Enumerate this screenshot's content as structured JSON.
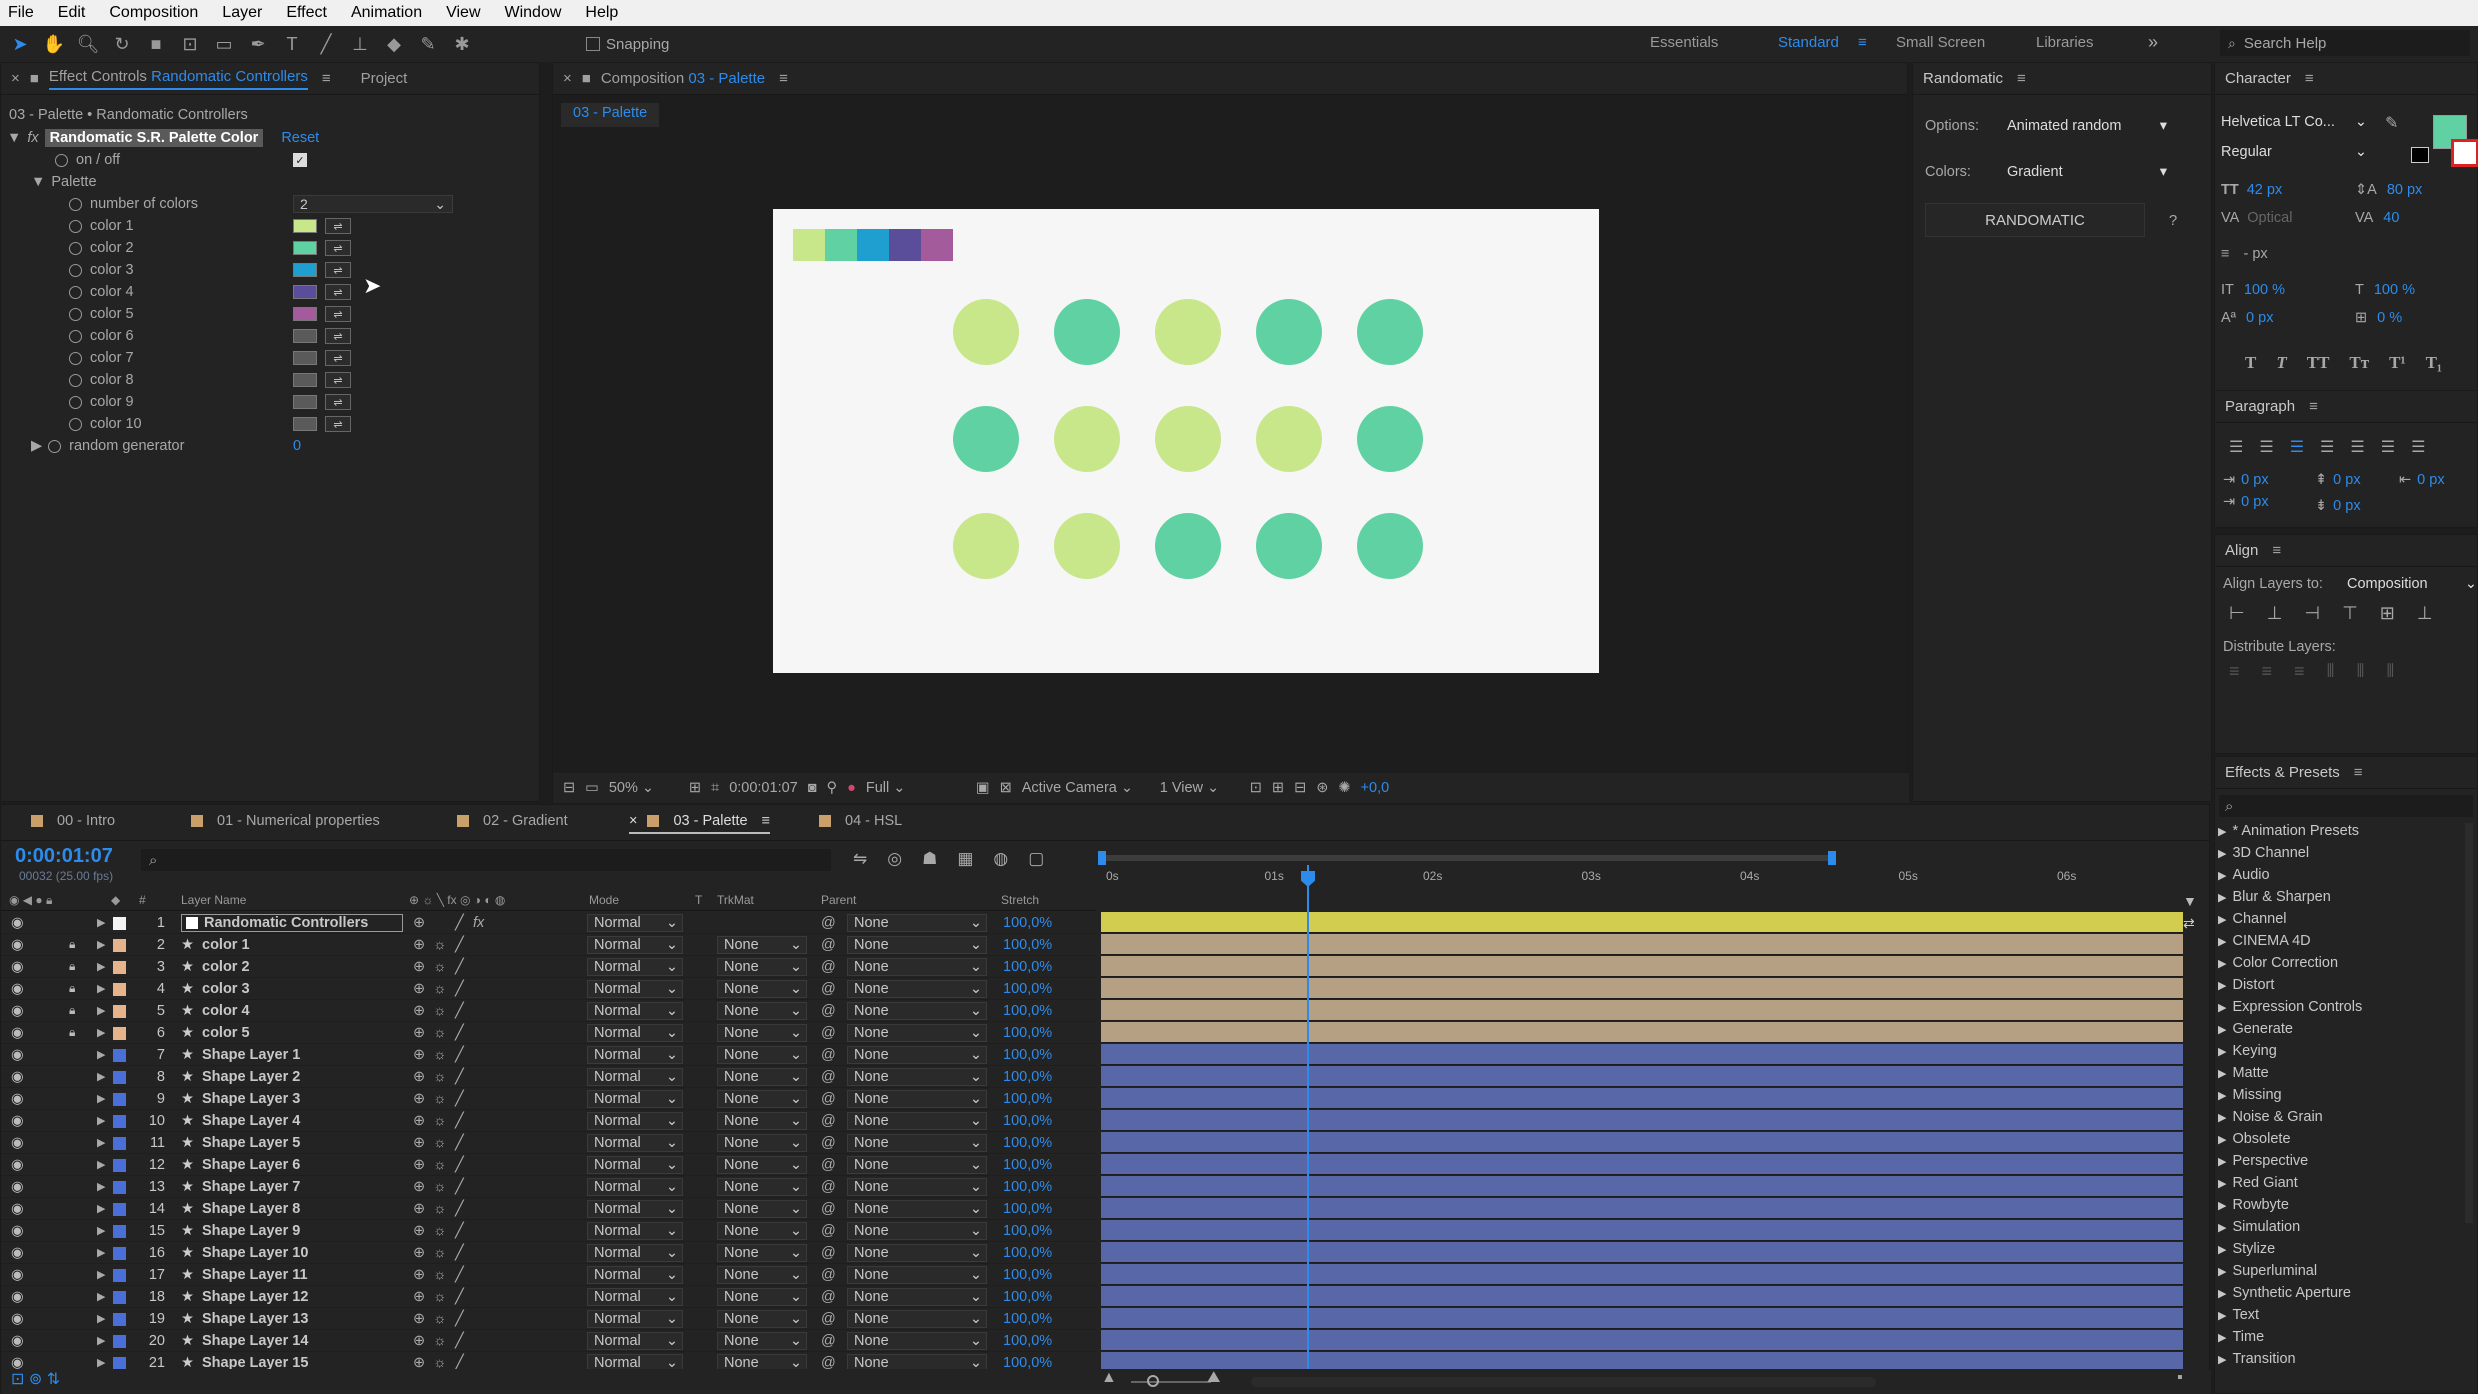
{
  "menu": [
    "File",
    "Edit",
    "Composition",
    "Layer",
    "Effect",
    "Animation",
    "View",
    "Window",
    "Help"
  ],
  "toolbar": {
    "snapping_label": "Snapping",
    "workspaces": [
      "Essentials",
      "Standard",
      "Small Screen",
      "Libraries"
    ],
    "active_workspace": "Standard",
    "search_placeholder": "Search Help"
  },
  "effect_controls": {
    "tab_prefix": "Effect Controls",
    "tab_layer": "Randomatic Controllers",
    "tab_project": "Project",
    "breadcrumb": "03 - Palette • Randomatic Controllers",
    "effect_name": "Randomatic S.R. Palette Color",
    "reset_label": "Reset",
    "on_off_label": "on / off",
    "palette_label": "Palette",
    "number_of_colors_label": "number of colors",
    "number_of_colors_value": "2",
    "colors": [
      {
        "label": "color 1",
        "hex": "#c8e68a"
      },
      {
        "label": "color 2",
        "hex": "#5fd1a3"
      },
      {
        "label": "color 3",
        "hex": "#1f9fcf"
      },
      {
        "label": "color 4",
        "hex": "#5a4e9a"
      },
      {
        "label": "color 5",
        "hex": "#a45b9c"
      },
      {
        "label": "color 6",
        "hex": "#5a5a5a"
      },
      {
        "label": "color 7",
        "hex": "#5a5a5a"
      },
      {
        "label": "color 8",
        "hex": "#5a5a5a"
      },
      {
        "label": "color 9",
        "hex": "#5a5a5a"
      },
      {
        "label": "color 10",
        "hex": "#5a5a5a"
      }
    ],
    "random_generator_label": "random generator",
    "random_generator_value": "0"
  },
  "composition": {
    "tab_prefix": "Composition",
    "tab_name": "03 - Palette",
    "sub_tab": "03 - Palette",
    "palette_strip": [
      "#c8e68a",
      "#5fd1a3",
      "#1f9fcf",
      "#5a4e9a",
      "#a45b9c"
    ],
    "dots": [
      [
        "#c8e68a",
        "#5fd1a3",
        "#c8e68a",
        "#5fd1a3",
        "#5fd1a3"
      ],
      [
        "#5fd1a3",
        "#c8e68a",
        "#c8e68a",
        "#c8e68a",
        "#5fd1a3"
      ],
      [
        "#c8e68a",
        "#c8e68a",
        "#5fd1a3",
        "#5fd1a3",
        "#5fd1a3"
      ]
    ],
    "footer": {
      "zoom": "50%",
      "timecode": "0:00:01:07",
      "resolution": "Full",
      "camera": "Active Camera",
      "views": "1 View",
      "exposure": "+0,0"
    }
  },
  "randomatic": {
    "title": "Randomatic",
    "options_label": "Options:",
    "options_value": "Animated random",
    "colors_label": "Colors:",
    "colors_value": "Gradient",
    "button_label": "RANDOMATIC",
    "help_label": "?"
  },
  "character": {
    "title": "Character",
    "font": "Helvetica LT Co...",
    "style": "Regular",
    "size": "42 px",
    "leading": "80 px",
    "kerning": "Optical",
    "tracking": "40",
    "stroke": "- px",
    "vscale": "100 %",
    "hscale": "100 %",
    "baseline": "0 px",
    "tsume": "0 %",
    "fill_color": "#5fd1a3"
  },
  "paragraph": {
    "title": "Paragraph",
    "indent_left": "0 px",
    "space_before": "0 px",
    "indent_right": "0 px",
    "indent_first": "0 px",
    "space_after": "0 px"
  },
  "align": {
    "title": "Align",
    "align_to_label": "Align Layers to:",
    "align_to_value": "Composition",
    "distribute_label": "Distribute Layers:"
  },
  "effects_presets": {
    "title": "Effects & Presets",
    "search_placeholder": "",
    "items": [
      "* Animation Presets",
      "3D Channel",
      "Audio",
      "Blur & Sharpen",
      "Channel",
      "CINEMA 4D",
      "Color Correction",
      "Distort",
      "Expression Controls",
      "Generate",
      "Keying",
      "Matte",
      "Missing",
      "Noise & Grain",
      "Obsolete",
      "Perspective",
      "Red Giant",
      "Rowbyte",
      "Simulation",
      "Stylize",
      "Superluminal",
      "Synthetic Aperture",
      "Text",
      "Time",
      "Transition"
    ]
  },
  "timeline": {
    "tabs": [
      {
        "label": "00 - Intro",
        "color": "#c9a06a"
      },
      {
        "label": "01 - Numerical properties",
        "color": "#c9a06a"
      },
      {
        "label": "02 - Gradient",
        "color": "#c9a06a"
      },
      {
        "label": "03 - Palette",
        "color": "#c9a06a"
      },
      {
        "label": "04 - HSL",
        "color": "#c9a06a"
      }
    ],
    "active_tab": "03 - Palette",
    "timecode": "0:00:01:07",
    "frame_info": "00032 (25.00 fps)",
    "columns": {
      "name": "Layer Name",
      "mode": "Mode",
      "t": "T",
      "trkmat": "TrkMat",
      "parent": "Parent",
      "stretch": "Stretch",
      "num": "#"
    },
    "ruler": [
      "0s",
      "01s",
      "02s",
      "03s",
      "04s",
      "05s",
      "06s"
    ],
    "layers": [
      {
        "num": "1",
        "name": "Randomatic Controllers",
        "label": "#f2f2f2",
        "mode": "Normal",
        "trkmat": "",
        "parent": "None",
        "stretch": "100,0%",
        "bar": "#d2cd4e",
        "locked": false,
        "solid": true
      },
      {
        "num": "2",
        "name": "color 1",
        "label": "#e7b38a",
        "mode": "Normal",
        "trkmat": "None",
        "parent": "None",
        "stretch": "100,0%",
        "bar": "#b5a084",
        "locked": true
      },
      {
        "num": "3",
        "name": "color 2",
        "label": "#e7b38a",
        "mode": "Normal",
        "trkmat": "None",
        "parent": "None",
        "stretch": "100,0%",
        "bar": "#b5a084",
        "locked": true
      },
      {
        "num": "4",
        "name": "color 3",
        "label": "#e7b38a",
        "mode": "Normal",
        "trkmat": "None",
        "parent": "None",
        "stretch": "100,0%",
        "bar": "#b5a084",
        "locked": true
      },
      {
        "num": "5",
        "name": "color 4",
        "label": "#e7b38a",
        "mode": "Normal",
        "trkmat": "None",
        "parent": "None",
        "stretch": "100,0%",
        "bar": "#b5a084",
        "locked": true
      },
      {
        "num": "6",
        "name": "color 5",
        "label": "#e7b38a",
        "mode": "Normal",
        "trkmat": "None",
        "parent": "None",
        "stretch": "100,0%",
        "bar": "#b5a084",
        "locked": true
      },
      {
        "num": "7",
        "name": "Shape Layer 1",
        "label": "#4a6fd8",
        "mode": "Normal",
        "trkmat": "None",
        "parent": "None",
        "stretch": "100,0%",
        "bar": "#5867a8",
        "locked": false
      },
      {
        "num": "8",
        "name": "Shape Layer 2",
        "label": "#4a6fd8",
        "mode": "Normal",
        "trkmat": "None",
        "parent": "None",
        "stretch": "100,0%",
        "bar": "#5867a8",
        "locked": false
      },
      {
        "num": "9",
        "name": "Shape Layer 3",
        "label": "#4a6fd8",
        "mode": "Normal",
        "trkmat": "None",
        "parent": "None",
        "stretch": "100,0%",
        "bar": "#5867a8",
        "locked": false
      },
      {
        "num": "10",
        "name": "Shape Layer 4",
        "label": "#4a6fd8",
        "mode": "Normal",
        "trkmat": "None",
        "parent": "None",
        "stretch": "100,0%",
        "bar": "#5867a8",
        "locked": false
      },
      {
        "num": "11",
        "name": "Shape Layer 5",
        "label": "#4a6fd8",
        "mode": "Normal",
        "trkmat": "None",
        "parent": "None",
        "stretch": "100,0%",
        "bar": "#5867a8",
        "locked": false
      },
      {
        "num": "12",
        "name": "Shape Layer 6",
        "label": "#4a6fd8",
        "mode": "Normal",
        "trkmat": "None",
        "parent": "None",
        "stretch": "100,0%",
        "bar": "#5867a8",
        "locked": false
      },
      {
        "num": "13",
        "name": "Shape Layer 7",
        "label": "#4a6fd8",
        "mode": "Normal",
        "trkmat": "None",
        "parent": "None",
        "stretch": "100,0%",
        "bar": "#5867a8",
        "locked": false
      },
      {
        "num": "14",
        "name": "Shape Layer 8",
        "label": "#4a6fd8",
        "mode": "Normal",
        "trkmat": "None",
        "parent": "None",
        "stretch": "100,0%",
        "bar": "#5867a8",
        "locked": false
      },
      {
        "num": "15",
        "name": "Shape Layer 9",
        "label": "#4a6fd8",
        "mode": "Normal",
        "trkmat": "None",
        "parent": "None",
        "stretch": "100,0%",
        "bar": "#5867a8",
        "locked": false
      },
      {
        "num": "16",
        "name": "Shape Layer 10",
        "label": "#4a6fd8",
        "mode": "Normal",
        "trkmat": "None",
        "parent": "None",
        "stretch": "100,0%",
        "bar": "#5867a8",
        "locked": false
      },
      {
        "num": "17",
        "name": "Shape Layer 11",
        "label": "#4a6fd8",
        "mode": "Normal",
        "trkmat": "None",
        "parent": "None",
        "stretch": "100,0%",
        "bar": "#5867a8",
        "locked": false
      },
      {
        "num": "18",
        "name": "Shape Layer 12",
        "label": "#4a6fd8",
        "mode": "Normal",
        "trkmat": "None",
        "parent": "None",
        "stretch": "100,0%",
        "bar": "#5867a8",
        "locked": false
      },
      {
        "num": "19",
        "name": "Shape Layer 13",
        "label": "#4a6fd8",
        "mode": "Normal",
        "trkmat": "None",
        "parent": "None",
        "stretch": "100,0%",
        "bar": "#5867a8",
        "locked": false
      },
      {
        "num": "20",
        "name": "Shape Layer 14",
        "label": "#4a6fd8",
        "mode": "Normal",
        "trkmat": "None",
        "parent": "None",
        "stretch": "100,0%",
        "bar": "#5867a8",
        "locked": false
      },
      {
        "num": "21",
        "name": "Shape Layer 15",
        "label": "#4a6fd8",
        "mode": "Normal",
        "trkmat": "None",
        "parent": "None",
        "stretch": "100,0%",
        "bar": "#5867a8",
        "locked": false
      }
    ]
  }
}
